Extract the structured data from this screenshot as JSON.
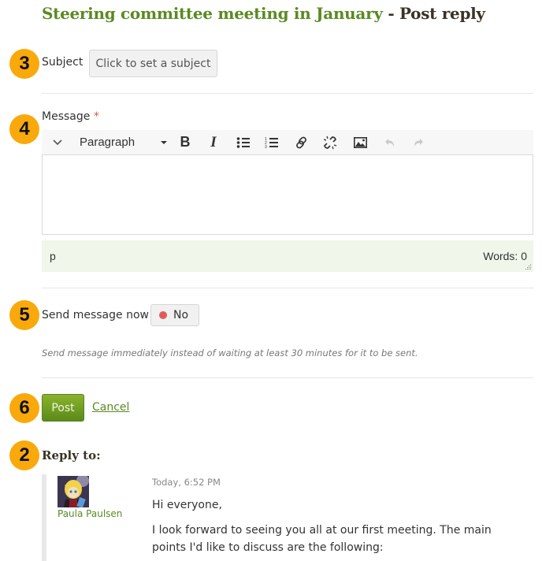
{
  "header": {
    "topic_link": "Steering committee meeting in January",
    "separator_title": " - Post reply"
  },
  "callouts": {
    "subject": "3",
    "message": "4",
    "send_now": "5",
    "post": "6",
    "reply_to": "2"
  },
  "subject": {
    "label": "Subject",
    "button_label": "Click to set a subject"
  },
  "message": {
    "label": "Message",
    "required_marker": "*",
    "toolbar": {
      "toggle_icon": "chevron-down-icon",
      "format_select": "Paragraph",
      "buttons": [
        {
          "name": "bold-icon",
          "glyph": "B"
        },
        {
          "name": "italic-icon",
          "glyph": "I"
        },
        {
          "name": "bullet-list-icon",
          "glyph": "•≡"
        },
        {
          "name": "numbered-list-icon",
          "glyph": "1≡"
        },
        {
          "name": "link-icon",
          "glyph": "🔗"
        },
        {
          "name": "unlink-icon",
          "glyph": "⛓"
        },
        {
          "name": "image-icon",
          "glyph": "▣"
        },
        {
          "name": "undo-icon",
          "glyph": "↶"
        },
        {
          "name": "redo-icon",
          "glyph": "↷"
        }
      ]
    },
    "body_value": "",
    "status_path": "p",
    "word_count": "Words: 0"
  },
  "send_now": {
    "label": "Send message now",
    "toggle_label": "No",
    "toggle_state": "off",
    "toggle_color": "#e05c5c",
    "hint": "Send message immediately instead of waiting at least 30 minutes for it to be sent."
  },
  "actions": {
    "post_label": "Post",
    "cancel_label": "Cancel"
  },
  "reply_to": {
    "heading": "Reply to:",
    "author": "Paula Paulsen",
    "timestamp": "Today, 6:52 PM",
    "paragraphs": [
      "Hi everyone,",
      "I look forward to seeing you all at our first meeting. The main points I'd like to discuss are the following:"
    ]
  },
  "colors": {
    "accent_green": "#5a8a22",
    "callout_orange": "#f9a90b",
    "statusbar_bg": "#f0f6ea"
  }
}
